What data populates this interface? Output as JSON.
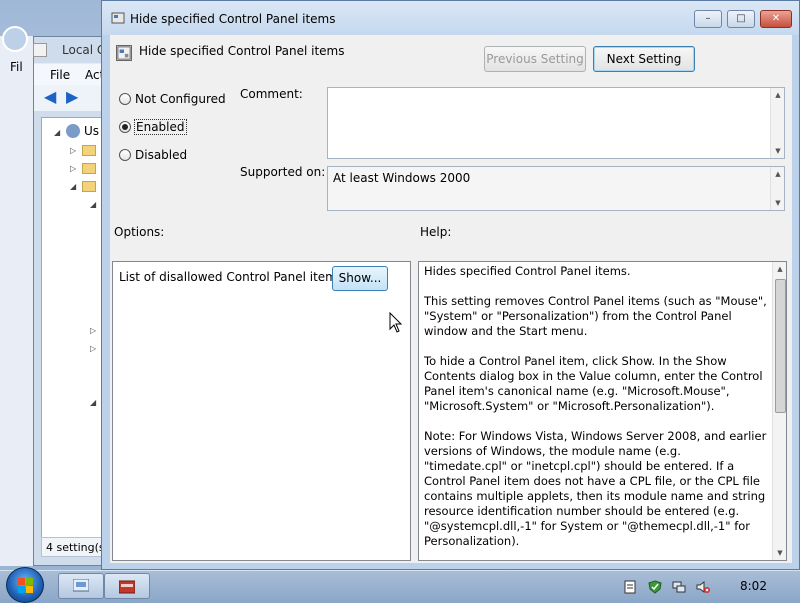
{
  "background_window": {
    "title": "Local G",
    "menu": [
      "File",
      "Act"
    ],
    "tree_root_label": "Us",
    "status": "4 setting(s)"
  },
  "left_edge": {
    "menu_stub": "Fil"
  },
  "dialog": {
    "window_title": "Hide specified Control Panel items",
    "header_title": "Hide specified Control Panel items",
    "buttons": {
      "previous": "Previous Setting",
      "next": "Next Setting",
      "minimize": "–",
      "maximize": "□",
      "close": "✕"
    },
    "state_options": [
      {
        "label": "Not Configured",
        "checked": false
      },
      {
        "label": "Enabled",
        "checked": true
      },
      {
        "label": "Disabled",
        "checked": false
      }
    ],
    "comment_label": "Comment:",
    "comment_value": "",
    "supported_label": "Supported on:",
    "supported_value": "At least Windows 2000",
    "options_label": "Options:",
    "help_label": "Help:",
    "options": {
      "list_label": "List of disallowed Control Panel items",
      "show_button": "Show..."
    },
    "help_paragraphs": [
      "Hides specified Control Panel items.",
      "This setting removes Control Panel items (such as \"Mouse\", \"System\" or \"Personalization\") from the Control Panel window and the Start menu.",
      "To hide a Control Panel item, click Show. In the Show Contents dialog box in the Value column, enter the Control Panel item's canonical name (e.g. \"Microsoft.Mouse\", \"Microsoft.System\" or \"Microsoft.Personalization\").",
      "Note: For Windows Vista, Windows Server 2008, and earlier versions of Windows, the module name (e.g. \"timedate.cpl\" or \"inetcpl.cpl\") should be entered. If a Control Panel item does not have a CPL file, or the CPL file contains multiple applets, then its module name and string resource identification number should be entered (e.g. \"@systemcpl.dll,-1\" for System or \"@themecpl.dll,-1\" for Personalization)."
    ]
  },
  "taskbar": {
    "clock": "8:02",
    "tray_icons": [
      "action-center-icon",
      "shield-check-icon",
      "network-icon",
      "volume-muted-icon"
    ],
    "pinned": [
      "group-policy-icon",
      "control-panel-icon"
    ]
  }
}
